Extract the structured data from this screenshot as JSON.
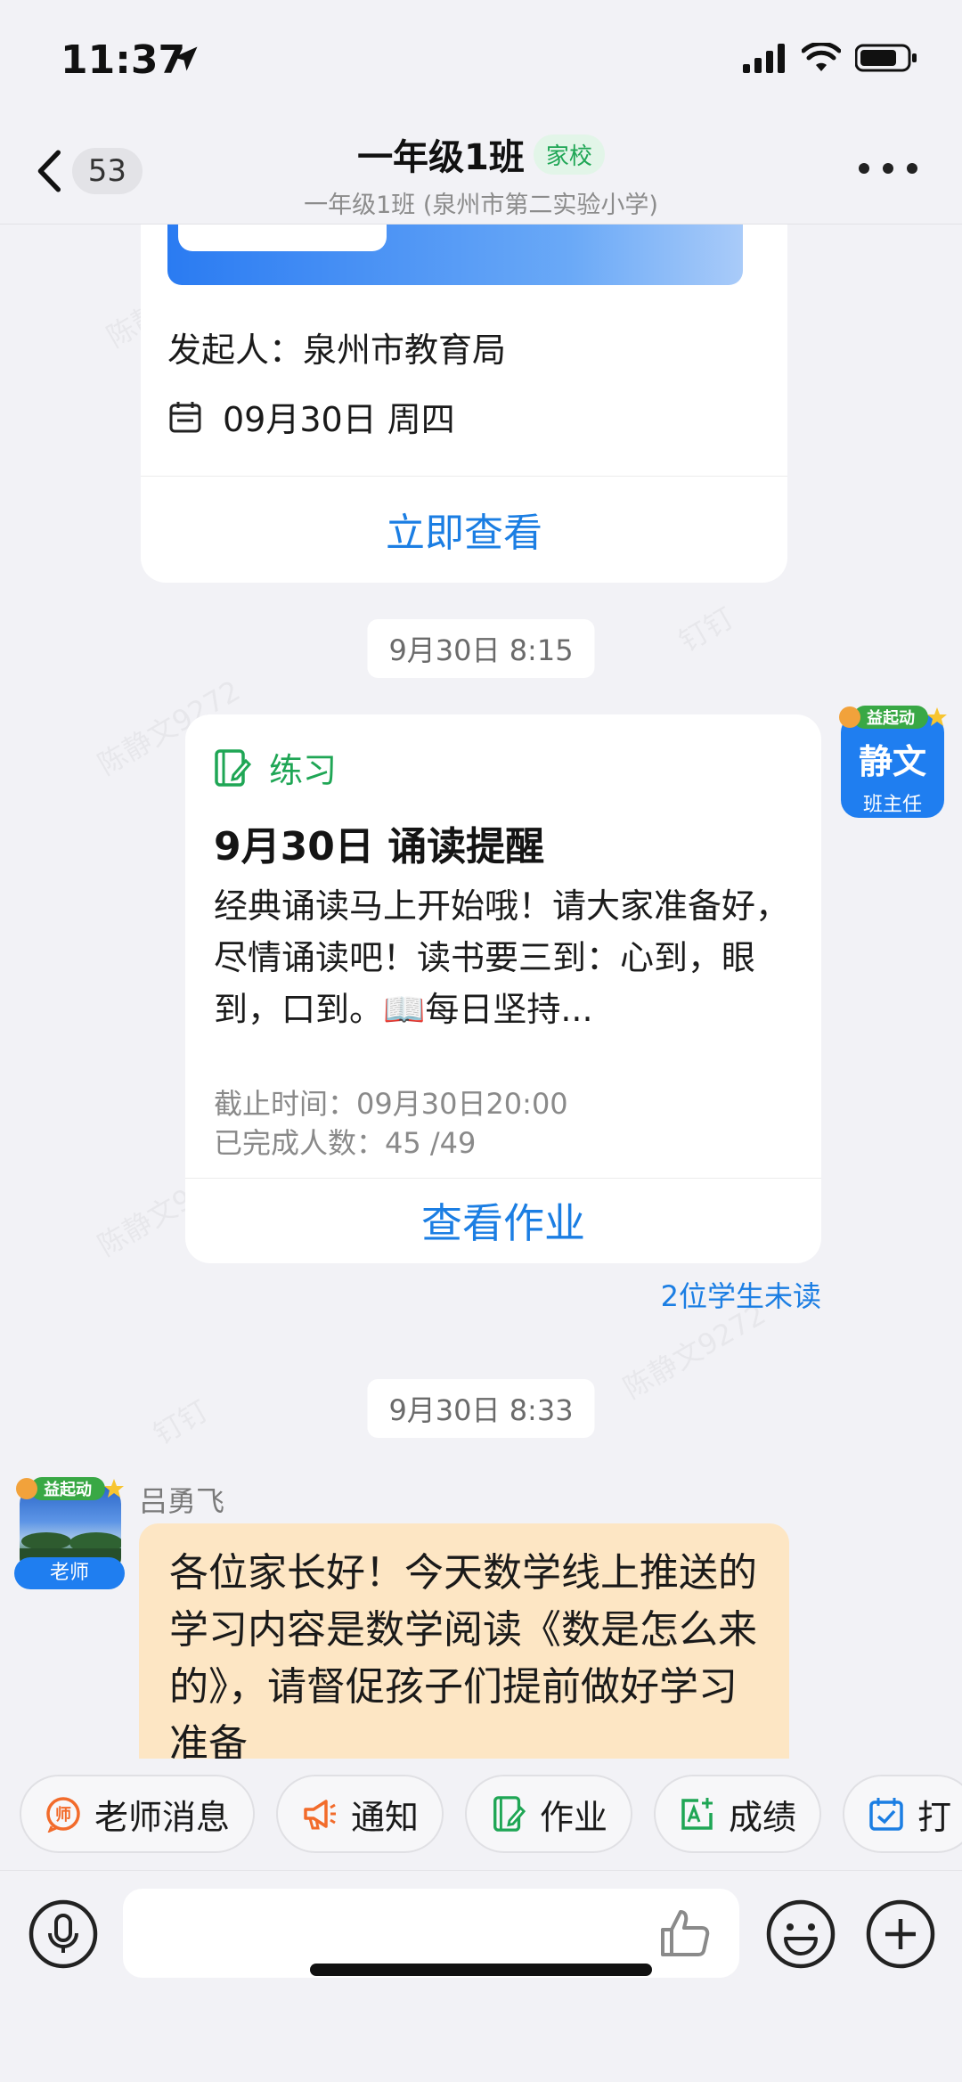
{
  "status_bar": {
    "time": "11:37"
  },
  "header": {
    "back_count": "53",
    "title": "一年级1班",
    "tag": "家校",
    "subtitle": "一年级1班 (泉州市第二实验小学)"
  },
  "watermark_text": "陈静文9272",
  "watermark_brand": "钉钉",
  "card1": {
    "initiator": "发起人：泉州市教育局",
    "date": "09月30日 周四",
    "action": "立即查看"
  },
  "times": [
    "9月30日 8:15",
    "9月30日 8:33"
  ],
  "homework_card": {
    "type": "练习",
    "title": "9月30日 诵读提醒",
    "body": "  经典诵读马上开始哦！请大家准备好，尽情诵读吧！读书要三到：心到，眼到，口到。📖每日坚持...",
    "deadline": "截止时间：09月30日20:00",
    "completed": "已完成人数：45 /49",
    "action": "查看作业",
    "unread": "2位学生未读"
  },
  "teacher_avatar_right": {
    "name": "静文",
    "role": "班主任",
    "badge": "益起动"
  },
  "message": {
    "sender": "吕勇飞",
    "role": "老师",
    "badge": "益起动",
    "text": "各位家长好！今天数学线上推送的学习内容是数学阅读《数是怎么来的》，请督促孩子们提前做好学习准备"
  },
  "quick_actions": [
    {
      "label": "老师消息",
      "icon": "teacher-icon",
      "color": "#f26b2b"
    },
    {
      "label": "通知",
      "icon": "megaphone-icon",
      "color": "#f26b2b"
    },
    {
      "label": "作业",
      "icon": "homework-icon",
      "color": "#1fa655"
    },
    {
      "label": "成绩",
      "icon": "grade-icon",
      "color": "#1fa655"
    },
    {
      "label": "打",
      "icon": "checkin-icon",
      "color": "#1b7ee3"
    }
  ],
  "input": {
    "placeholder": ""
  }
}
